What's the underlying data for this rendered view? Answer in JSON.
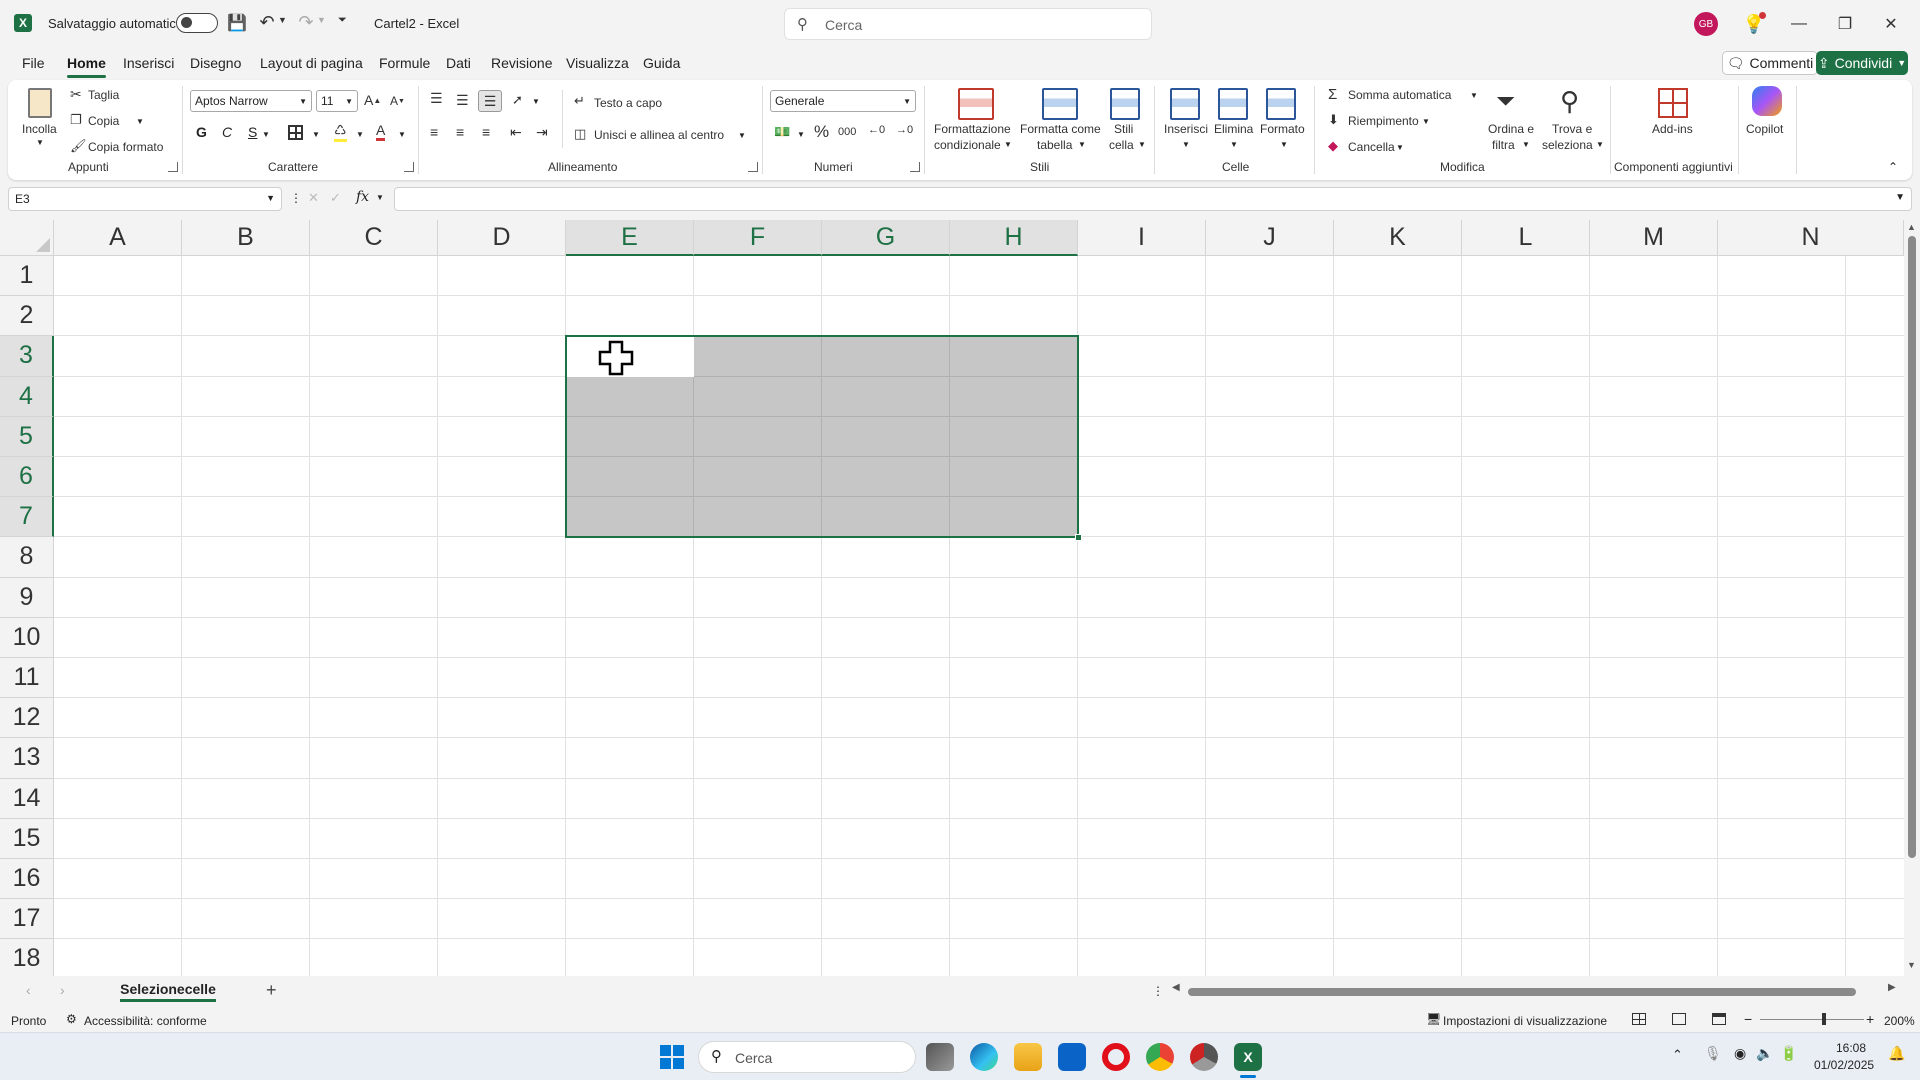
{
  "titlebar": {
    "autosave_label": "Salvataggio automatico",
    "doc_title": "Cartel2 - Excel",
    "search_placeholder": "Cerca",
    "avatar_initials": "GB"
  },
  "menu": {
    "tabs": [
      "File",
      "Home",
      "Inserisci",
      "Disegno",
      "Layout di pagina",
      "Formule",
      "Dati",
      "Revisione",
      "Visualizza",
      "Guida"
    ],
    "comments_label": "Commenti",
    "share_label": "Condividi"
  },
  "ribbon": {
    "clipboard": {
      "paste": "Incolla",
      "cut": "Taglia",
      "copy": "Copia",
      "format_painter": "Copia formato",
      "group": "Appunti"
    },
    "font": {
      "name": "Aptos Narrow",
      "size": "11",
      "bold": "G",
      "italic": "C",
      "underline": "S",
      "group": "Carattere"
    },
    "alignment": {
      "wrap": "Testo a capo",
      "merge": "Unisci e allinea al centro",
      "group": "Allineamento"
    },
    "number": {
      "format": "Generale",
      "group": "Numeri"
    },
    "styles": {
      "conditional_1": "Formattazione",
      "conditional_2": "condizionale",
      "table_1": "Formatta come",
      "table_2": "tabella",
      "cell_1": "Stili",
      "cell_2": "cella",
      "group": "Stili"
    },
    "cells": {
      "insert": "Inserisci",
      "delete": "Elimina",
      "format": "Formato",
      "group": "Celle"
    },
    "editing": {
      "autosum": "Somma automatica",
      "fill": "Riempimento",
      "clear": "Cancella",
      "sort_1": "Ordina e",
      "sort_2": "filtra",
      "find_1": "Trova e",
      "find_2": "seleziona",
      "group": "Modifica"
    },
    "addins": {
      "label": "Add-ins",
      "group": "Componenti aggiuntivi"
    },
    "copilot": "Copilot"
  },
  "formula_bar": {
    "name_box": "E3",
    "fx": "fx",
    "content": ""
  },
  "grid": {
    "columns": [
      "A",
      "B",
      "C",
      "D",
      "E",
      "F",
      "G",
      "H",
      "I",
      "J",
      "K",
      "L",
      "M",
      "N"
    ],
    "rows": [
      "1",
      "2",
      "3",
      "4",
      "5",
      "6",
      "7",
      "8",
      "9",
      "10",
      "11",
      "12",
      "13",
      "14",
      "15",
      "16",
      "17",
      "18"
    ],
    "selection": "E3:H7",
    "selected_columns": [
      "E",
      "F",
      "G",
      "H"
    ],
    "selected_rows": [
      "3",
      "4",
      "5",
      "6",
      "7"
    ]
  },
  "sheets": {
    "active": "Selezionecelle"
  },
  "status": {
    "ready": "Pronto",
    "accessibility": "Accessibilità: conforme",
    "display_settings": "Impostazioni di visualizzazione",
    "zoom": "200%"
  },
  "taskbar": {
    "search_placeholder": "Cerca",
    "time": "16:08",
    "date": "01/02/2025"
  },
  "colors": {
    "accent": "#1e7145",
    "selection": "#c6c6c6",
    "share_button": "#1e7145"
  }
}
